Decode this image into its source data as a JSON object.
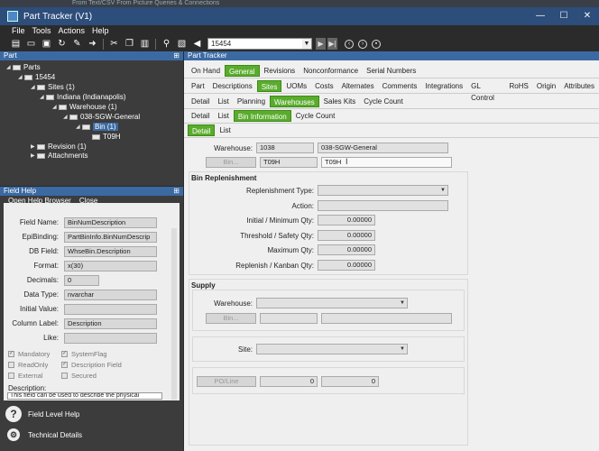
{
  "window": {
    "strip_text": "From Text/CSV      From Picture      Queries & Connections",
    "title": "Part Tracker (V1)",
    "controls": [
      "—",
      "☐",
      "✕"
    ]
  },
  "menu": [
    "File",
    "Tools",
    "Actions",
    "Help"
  ],
  "toolbar": {
    "part_value": "15454"
  },
  "tree_panel": {
    "title": "Part",
    "nodes": [
      {
        "label": "Parts"
      },
      {
        "label": "15454"
      },
      {
        "label": "Sites (1)"
      },
      {
        "label": "Indiana (Indianapolis)"
      },
      {
        "label": "Warehouse (1)"
      },
      {
        "label": "038-SGW-General"
      },
      {
        "label": "Bin (1)"
      },
      {
        "label": "T09H"
      },
      {
        "label": "Revision (1)"
      },
      {
        "label": "Attachments"
      }
    ]
  },
  "field_help": {
    "title": "Field Help",
    "menu": [
      "Open Help Browser",
      "Close"
    ],
    "fields": [
      {
        "label": "Field Name:",
        "value": "BinNumDescription"
      },
      {
        "label": "EpiBinding:",
        "value": "PartBinInfo.BinNumDescrip"
      },
      {
        "label": "DB Field:",
        "value": "WhseBin.Description"
      },
      {
        "label": "Format:",
        "value": "x(30)"
      },
      {
        "label": "Decimals:",
        "value": "0"
      },
      {
        "label": "Data Type:",
        "value": "nvarchar"
      },
      {
        "label": "Initial Value:",
        "value": ""
      },
      {
        "label": "Column Label:",
        "value": "Description"
      },
      {
        "label": "Like:",
        "value": ""
      }
    ],
    "checks": [
      {
        "label": "Mandatory",
        "checked": true
      },
      {
        "label": "SystemFlag",
        "checked": true
      },
      {
        "label": "ReadOnly",
        "checked": false
      },
      {
        "label": "Description Field",
        "checked": true
      },
      {
        "label": "External",
        "checked": false
      },
      {
        "label": "Secured",
        "checked": false
      }
    ],
    "description_label": "Description:",
    "description_text": "This field can be used to describe the physical"
  },
  "bottom_left": {
    "items": [
      "Field Level Help",
      "Technical Details"
    ]
  },
  "main": {
    "title": "Part Tracker",
    "tabs_l1": [
      "On Hand",
      "General",
      "Revisions",
      "Nonconformance",
      "Serial Numbers"
    ],
    "tabs_l2": [
      "Part",
      "Descriptions",
      "Sites",
      "UOMs",
      "Costs",
      "Alternates",
      "Comments",
      "Integrations",
      "GL Control",
      "RoHS",
      "Origin",
      "Attributes"
    ],
    "tabs_l3": [
      "Detail",
      "List",
      "Planning",
      "Warehouses",
      "Sales Kits",
      "Cycle Count"
    ],
    "tabs_l4": [
      "Detail",
      "List",
      "Bin Information",
      "Cycle Count"
    ],
    "tabs_l5": [
      "Detail",
      "List"
    ],
    "warehouse_label": "Warehouse:",
    "warehouse_code": "1038",
    "warehouse_desc": "038-SGW-General",
    "bin_button": "Bin...",
    "bin_code": "T09H",
    "bin_desc": "T09H",
    "bin_replenishment": {
      "title": "Bin Replenishment",
      "replenishment_type_label": "Replenishment Type:",
      "action_label": "Action:",
      "min_label": "Initial / Minimum Qty:",
      "min_value": "0.00000",
      "safety_label": "Threshold / Safety Qty:",
      "safety_value": "0.00000",
      "max_label": "Maximum Qty:",
      "max_value": "0.00000",
      "kanban_label": "Replenish / Kanban Qty:",
      "kanban_value": "0.00000"
    },
    "supply": {
      "title": "Supply",
      "warehouse_label": "Warehouse:",
      "bin_button": "Bin...",
      "site_label": "Site:",
      "poline_button": "PO/Line",
      "po_value": "0",
      "line_value": "0"
    }
  }
}
